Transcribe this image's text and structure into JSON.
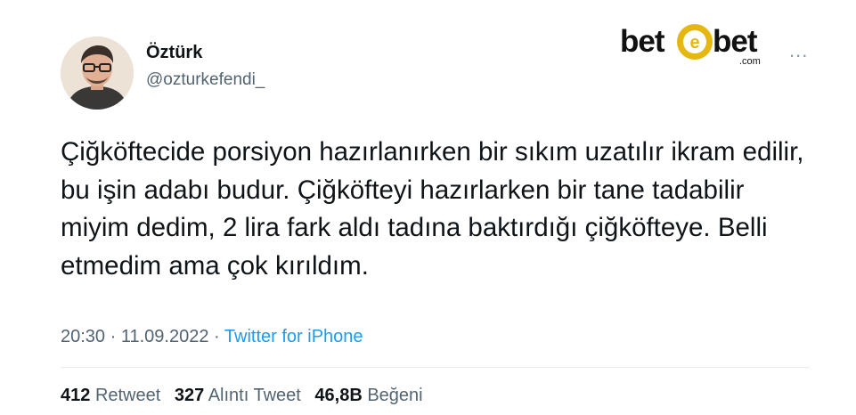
{
  "author": {
    "display_name": "Öztürk",
    "handle": "@ozturkefendi_",
    "avatar_icon": "person-avatar-photo"
  },
  "brand_logo": {
    "text_left": "bet",
    "text_right": "bet",
    "suffix": ".com",
    "icon": "chip-e-logo-icon",
    "colors": {
      "text": "#111111",
      "accent": "#e5b711"
    }
  },
  "more_menu": {
    "label": "...",
    "icon": "more-dots-icon"
  },
  "tweet": {
    "text": "Çiğköftecide porsiyon hazırlanırken bir sıkım uzatılır ikram edilir, bu işin adabı budur. Çiğköfteyi hazırlarken bir tane tadabilir miyim dedim, 2 lira fark aldı tadına baktırdığı çiğköfteye. Belli etmedim ama çok kırıldım."
  },
  "meta": {
    "time": "20:30",
    "separator": "·",
    "date": "11.09.2022",
    "source": "Twitter for iPhone"
  },
  "stats": {
    "retweets_count": "412",
    "retweets_label": "Retweet",
    "quotes_count": "327",
    "quotes_label": "Alıntı Tweet",
    "likes_count": "46,8B",
    "likes_label": "Beğeni"
  },
  "colors": {
    "text": "#0f1419",
    "secondary": "#536471",
    "link": "#1d9bf0",
    "divider": "#e6ecf0"
  }
}
